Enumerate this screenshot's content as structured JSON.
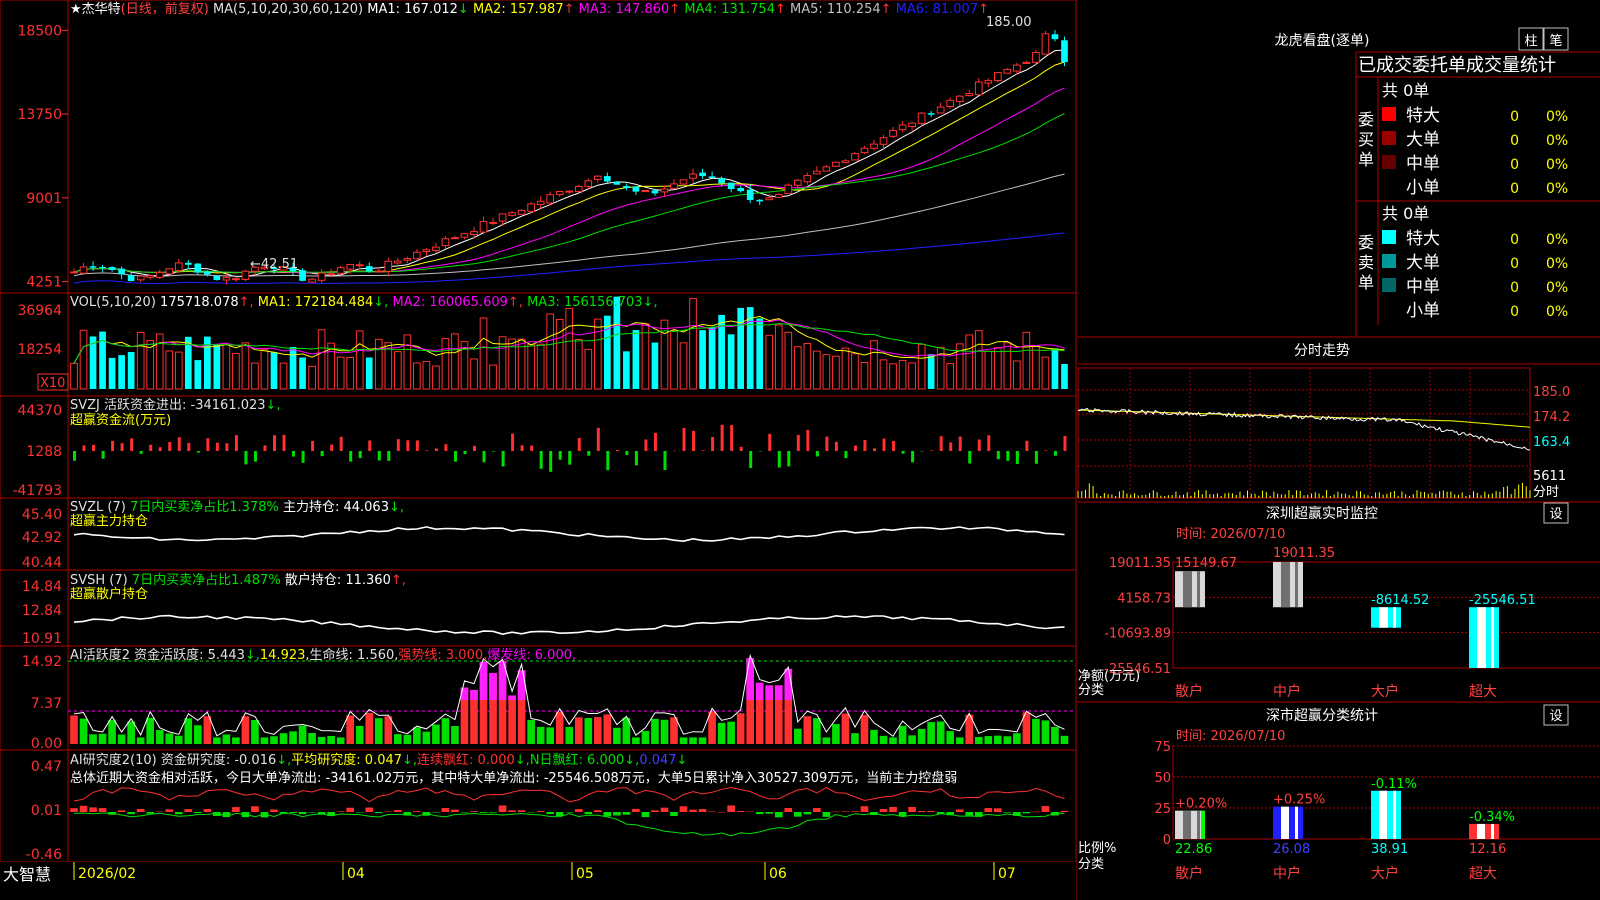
{
  "stock": {
    "name": "★杰华特",
    "mode": "(日线，前复权)"
  },
  "main": {
    "y_ticks": [
      "18500",
      "13750",
      "9001",
      "4251"
    ],
    "ma_label": "MA(5,10,20,30,60,120)",
    "ma": [
      {
        "t": "MA1: 167.012",
        "a": "↓",
        "c": "#ffffff"
      },
      {
        "t": "MA2: 157.987",
        "a": "↑",
        "c": "#ffff00"
      },
      {
        "t": "MA3: 147.860",
        "a": "↑",
        "c": "#ff00ff"
      },
      {
        "t": "MA4: 131.754",
        "a": "↑",
        "c": "#00e000"
      },
      {
        "t": "MA5: 110.254",
        "a": "↑",
        "c": "#c0c0c0"
      },
      {
        "t": "MA6: 81.007",
        "a": "↑",
        "c": "#2020ff"
      }
    ],
    "high_label": "185.00",
    "low_label": "←42.51"
  },
  "vol": {
    "title": "VOL(5,10,20)",
    "value": "175718.078",
    "value_arrow": "↑",
    "ma": [
      {
        "t": "MA1: 172184.484",
        "a": "↓",
        "c": "#ffff00"
      },
      {
        "t": "MA2: 160065.609",
        "a": "↑",
        "c": "#ff00ff"
      },
      {
        "t": "MA3: 156156.703",
        "a": "↓",
        "c": "#00e000"
      }
    ],
    "y_ticks": [
      "36964",
      "18254"
    ],
    "unit": "X10"
  },
  "svzj": {
    "title": "SVZJ",
    "text": "活跃资金进出: -34161.023",
    "arrow": "↓,",
    "sub": "超赢资金流(万元)",
    "y_ticks": [
      "44370",
      "1288",
      "-41793"
    ]
  },
  "svzl": {
    "title": "SVZL (7)",
    "green": "7日内买卖净占比1.378%",
    "white": "主力持仓: 44.063",
    "arrow": "↓,",
    "sub": "超赢主力持仓",
    "y_ticks": [
      "45.40",
      "42.92",
      "40.44"
    ]
  },
  "svsh": {
    "title": "SVSH (7)",
    "green": "7日内买卖净占比1.487%",
    "white": "散户持仓: 11.360",
    "arrow": "↑,",
    "sub": "超赢散户持仓",
    "y_ticks": [
      "14.84",
      "12.84",
      "10.91"
    ]
  },
  "ai1": {
    "parts": [
      {
        "t": "AI活跃度2 资金活跃度: 5.443",
        "c": "#e0e0e0"
      },
      {
        "t": "↓,",
        "c": "#00e000"
      },
      {
        "t": "14.923",
        "c": "#ffff00"
      },
      {
        "t": ",生命线: 1.560,",
        "c": "#e0e0e0"
      },
      {
        "t": "强势线: 3.000,",
        "c": "#ff3030"
      },
      {
        "t": "爆发线: 6.000,",
        "c": "#ff00ff"
      }
    ],
    "y_ticks": [
      "14.92",
      "7.37",
      "0.00"
    ]
  },
  "ai2": {
    "parts": [
      {
        "t": "AI研究度2(10) 资金研究度: -0.016",
        "c": "#e0e0e0"
      },
      {
        "t": "↓,",
        "c": "#00e000"
      },
      {
        "t": "平均研究度: 0.047",
        "c": "#ffff00"
      },
      {
        "t": "↓,",
        "c": "#00e000"
      },
      {
        "t": "连续飘红: 0.000",
        "c": "#ff3030"
      },
      {
        "t": "↓,",
        "c": "#00e000"
      },
      {
        "t": "N日飘红: 6.000",
        "c": "#00e000"
      },
      {
        "t": "↓,",
        "c": "#00e000"
      },
      {
        "t": "0.047",
        "c": "#4040ff"
      },
      {
        "t": "↓",
        "c": "#00e000"
      }
    ],
    "summary": "总体近期大资金相对活跃，今日大单净流出: -34161.02万元，其中特大单净流出: -25546.508万元，大单5日累计净入30527.309万元，当前主力控盘弱",
    "y_ticks": [
      "0.47",
      "0.01",
      "-0.46"
    ]
  },
  "xaxis": {
    "labels": [
      "2026/02",
      "04",
      "05",
      "06",
      "07"
    ]
  },
  "brand": "大智慧",
  "dragon": {
    "title": "龙虎看盘(逐单)",
    "btn1": "柱",
    "btn2": "笔",
    "header": "已成交委托单成交量统计",
    "buy_label": "委买单",
    "sell_label": "委卖单",
    "buy": {
      "total": "共 0单",
      "rows": [
        {
          "name": "特大",
          "n": "0",
          "p": "0%",
          "c": "#ff0000"
        },
        {
          "name": "大单",
          "n": "0",
          "p": "0%",
          "c": "#990000"
        },
        {
          "name": "中单",
          "n": "0",
          "p": "0%",
          "c": "#660000"
        },
        {
          "name": "小单",
          "n": "0",
          "p": "0%",
          "c": "#000000"
        }
      ]
    },
    "sell": {
      "total": "共 0单",
      "rows": [
        {
          "name": "特大",
          "n": "0",
          "p": "0%",
          "c": "#00ffff"
        },
        {
          "name": "大单",
          "n": "0",
          "p": "0%",
          "c": "#009999"
        },
        {
          "name": "中单",
          "n": "0",
          "p": "0%",
          "c": "#006666"
        },
        {
          "name": "小单",
          "n": "0",
          "p": "0%",
          "c": "#000000"
        }
      ]
    }
  },
  "fenshi": {
    "title": "分时走势",
    "ticks": [
      "185.0",
      "174.2",
      "163.4",
      "5611"
    ],
    "unit": "分时"
  },
  "monitor": {
    "title": "深圳超赢实时监控",
    "set": "设",
    "time": "时间: 2026/07/10",
    "y_ticks": [
      "19011.35",
      "4158.73",
      "-10693.89",
      "-25546.51"
    ],
    "y_unit1": "净额(万元)",
    "y_unit2": "分类",
    "chart_data": {
      "type": "bar",
      "categories": [
        "散户",
        "中户",
        "大户",
        "超大"
      ],
      "values": [
        15149.67,
        19011.35,
        -8614.52,
        -25546.51
      ],
      "value_labels": [
        "15149.67",
        "19011.35",
        "-8614.52",
        "-25546.51"
      ],
      "ylim": [
        -25546.51,
        19011.35
      ]
    }
  },
  "classify": {
    "title": "深市超赢分类统计",
    "set": "设",
    "time": "时间: 2026/07/10",
    "y_ticks": [
      "75",
      "50",
      "25",
      "0"
    ],
    "y_unit1": "比例%",
    "y_unit2": "分类",
    "chart_data": {
      "type": "bar",
      "categories": [
        "散户",
        "中户",
        "大户",
        "超大"
      ],
      "values": [
        22.86,
        26.08,
        38.91,
        12.16
      ],
      "value_labels": [
        "22.86",
        "26.08",
        "38.91",
        "12.16"
      ],
      "changes": [
        "+0.20%",
        "+0.25%",
        "-0.11%",
        "-0.34%"
      ],
      "ylim": [
        0,
        75
      ]
    }
  }
}
